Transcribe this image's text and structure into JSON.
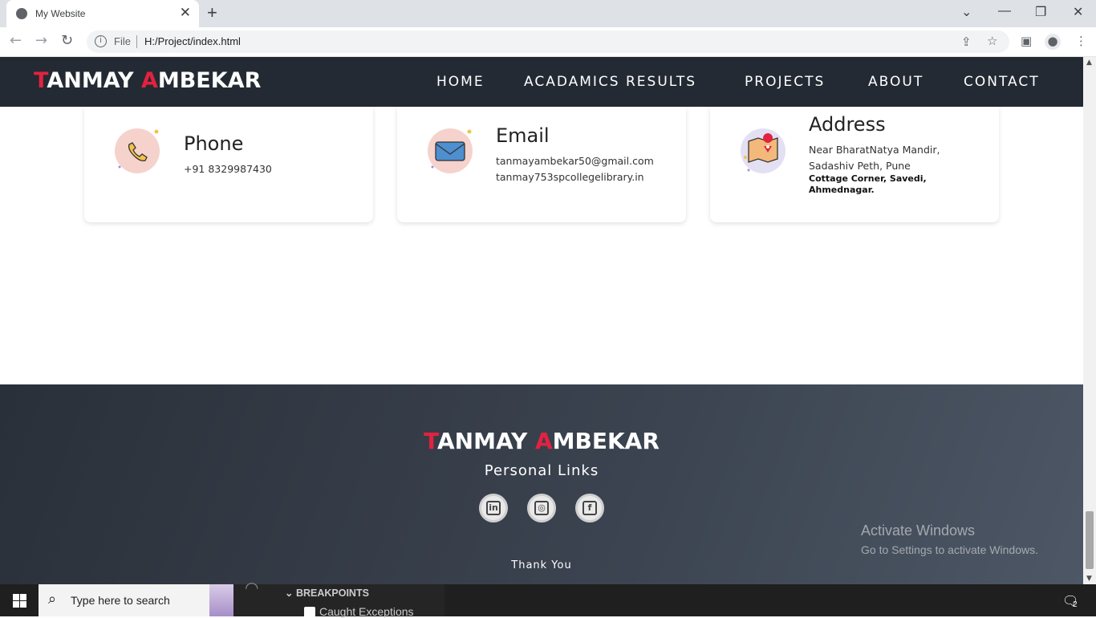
{
  "browser": {
    "tab_title": "My Website",
    "tab_close": "✕",
    "new_tab": "+",
    "address_scheme": "File",
    "address_url": "H:/Project/index.html"
  },
  "site": {
    "logo": {
      "first_initial": "T",
      "first_rest": "ANMAY ",
      "last_initial": "A",
      "last_rest": "MBEKAR"
    },
    "nav": [
      "HOME",
      "ACADAMICS RESULTS",
      "PROJECTS",
      "ABOUT",
      "CONTACT"
    ],
    "contact": {
      "phone": {
        "heading": "Phone",
        "lines": [
          "+91 8329987430"
        ]
      },
      "email": {
        "heading": "Email",
        "lines": [
          "tanmayambekar50@gmail.com",
          "tanmay753spcollegelibrary.in"
        ]
      },
      "address": {
        "heading": "Address",
        "lines": [
          "Near BharatNatya Mandir,",
          "Sadashiv Peth, Pune"
        ],
        "bold_lines": [
          "Cottage Corner, Savedi,",
          "Ahmednagar."
        ]
      }
    },
    "footer": {
      "logo": {
        "first_initial": "T",
        "first_rest": "ANMAY ",
        "last_initial": "A",
        "last_rest": "MBEKAR"
      },
      "personal_links": "Personal Links",
      "social": [
        {
          "name": "linkedin",
          "glyph": "in"
        },
        {
          "name": "instagram",
          "glyph": "◎"
        },
        {
          "name": "facebook",
          "glyph": "f"
        }
      ],
      "thanks": "Thank You"
    },
    "accent_color": "#e2223f"
  },
  "watermark": {
    "title": "Activate Windows",
    "subtitle": "Go to Settings to activate Windows."
  },
  "taskbar": {
    "search_placeholder": "Type here to search",
    "breakpoints_label": "BREAKPOINTS",
    "caught_exceptions": "Caught Exceptions",
    "notification_count": "2"
  }
}
